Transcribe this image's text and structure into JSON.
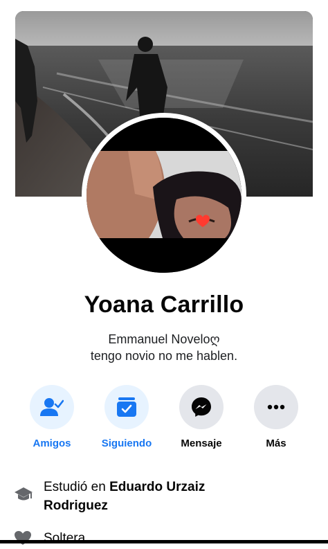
{
  "profile": {
    "name": "Yoana Carrillo",
    "bio_line1": "Emmanuel Noveloღ",
    "bio_line2": "tengo novio no me hablen."
  },
  "actions": [
    {
      "label": "Amigos",
      "icon": "friends-check-icon",
      "style": "active"
    },
    {
      "label": "Siguiendo",
      "icon": "following-inbox-icon",
      "style": "active"
    },
    {
      "label": "Mensaje",
      "icon": "messenger-icon",
      "style": "default"
    },
    {
      "label": "Más",
      "icon": "more-dots-icon",
      "style": "default"
    }
  ],
  "about": {
    "education_prefix": "Estudió en ",
    "education_school_line1": "Eduardo Urzaiz",
    "education_school_line2": "Rodriguez",
    "education_icon": "graduation-cap-icon",
    "relationship": "Soltera",
    "relationship_icon": "heart-icon"
  },
  "colors": {
    "accent": "#1877f2",
    "accent_bg": "#e7f3ff",
    "neutral_bg": "#e4e6eb",
    "text": "#050505"
  }
}
